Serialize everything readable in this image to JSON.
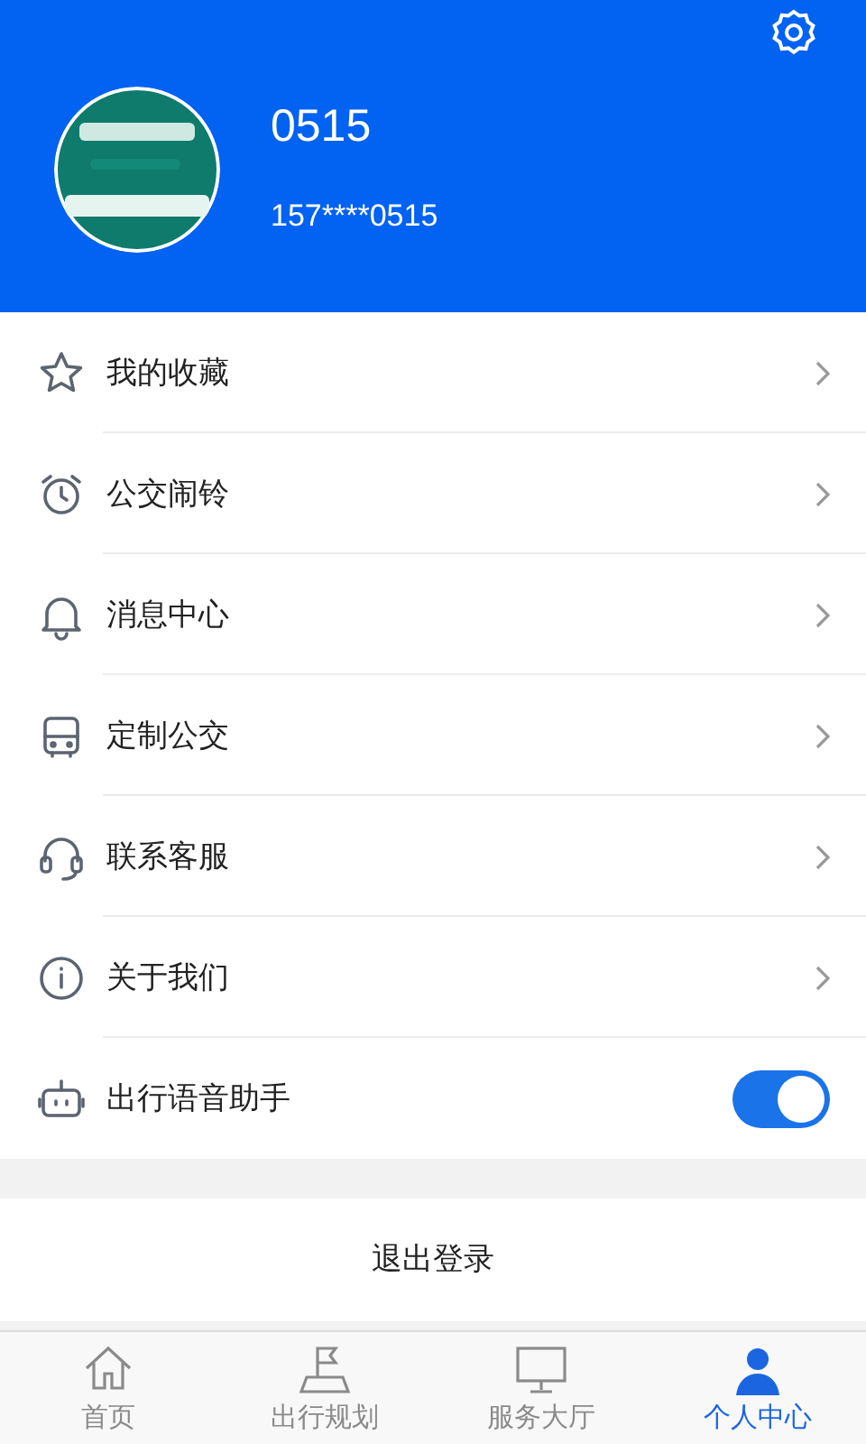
{
  "profile": {
    "name": "0515",
    "phone": "157****0515"
  },
  "menu": [
    {
      "label": "我的收藏",
      "kind": "link"
    },
    {
      "label": "公交闹铃",
      "kind": "link"
    },
    {
      "label": "消息中心",
      "kind": "link"
    },
    {
      "label": "定制公交",
      "kind": "link"
    },
    {
      "label": "联系客服",
      "kind": "link"
    },
    {
      "label": "关于我们",
      "kind": "link"
    },
    {
      "label": "出行语音助手",
      "kind": "toggle",
      "on": true
    }
  ],
  "logout": "退出登录",
  "tabs": [
    {
      "label": "首页",
      "selected": false
    },
    {
      "label": "出行规划",
      "selected": false
    },
    {
      "label": "服务大厅",
      "selected": false
    },
    {
      "label": "个人中心",
      "selected": true
    }
  ]
}
